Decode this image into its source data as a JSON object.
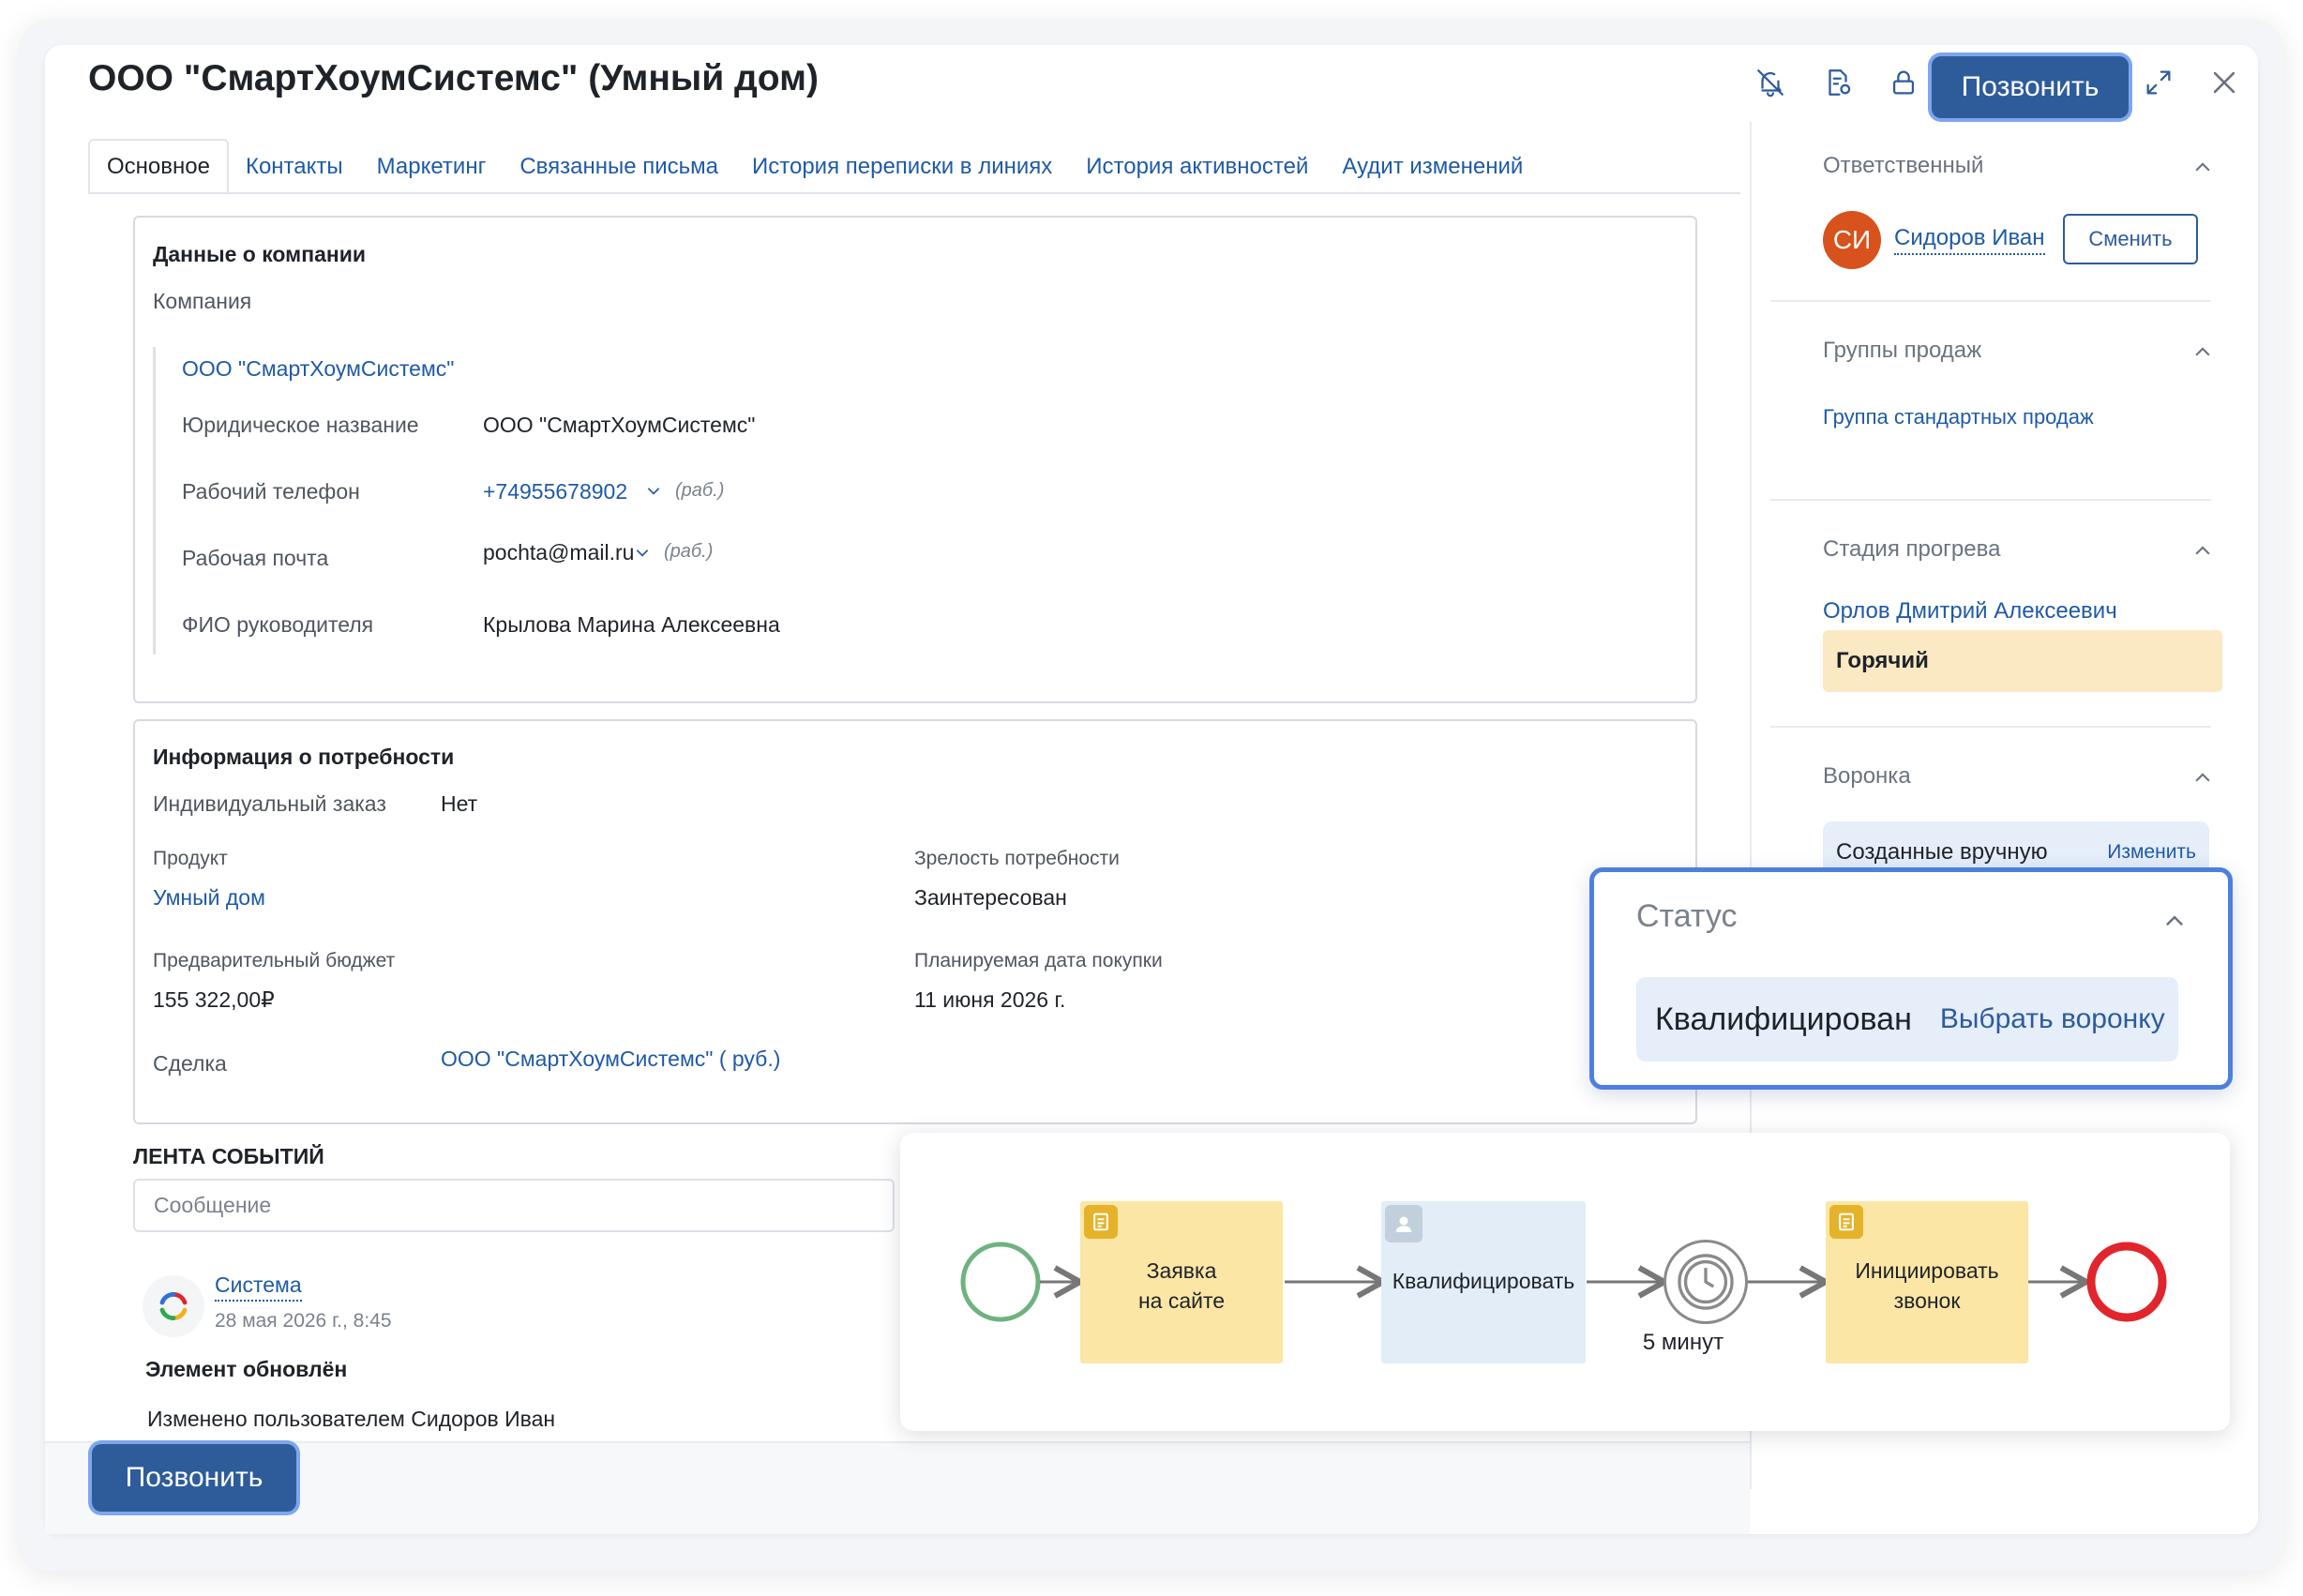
{
  "header": {
    "title": "ООО \"СмартХоумСистемс\" (Умный дом)",
    "call_label": "Позвонить"
  },
  "tabs": [
    {
      "label": "Основное",
      "active": true
    },
    {
      "label": "Контакты"
    },
    {
      "label": "Маркетинг"
    },
    {
      "label": "Связанные письма"
    },
    {
      "label": "История переписки в линиях"
    },
    {
      "label": "История активностей"
    },
    {
      "label": "Аудит изменений"
    }
  ],
  "company": {
    "section_title": "Данные о компании",
    "company_label": "Компания",
    "company_link": "ООО \"СмартХоумСистемс\"",
    "legal_name_label": "Юридическое название",
    "legal_name": "ООО \"СмартХоумСистемс\"",
    "phone_label": "Рабочий телефон",
    "phone": "+74955678902",
    "phone_tag": "(раб.)",
    "email_label": "Рабочая почта",
    "email": "pochta@mail.ru",
    "email_tag": "(раб.)",
    "head_label": "ФИО руководителя",
    "head": "Крылова Марина Алексеевна"
  },
  "need": {
    "section_title": "Информация о потребности",
    "individual_label": "Индивидуальный заказ",
    "individual": "Нет",
    "product_label": "Продукт",
    "product": "Умный дом",
    "maturity_label": "Зрелость потребности",
    "maturity": "Заинтересован",
    "budget_label": "Предварительный бюджет",
    "budget": "155 322,00₽",
    "purchase_date_label": "Планируемая дата покупки",
    "purchase_date": "11 июня 2026 г.",
    "deal_label": "Сделка",
    "deal": "ООО \"СмартХоумСистемс\" ( руб.)"
  },
  "feed": {
    "title": "ЛЕНТА СОБЫТИЙ",
    "message_placeholder": "Сообщение",
    "author": "Система",
    "date": "28 мая 2026 г., 8:45",
    "event_title": "Элемент обновлён",
    "event_text": "Изменено пользователем Сидоров Иван"
  },
  "sidebar": {
    "responsible": {
      "title": "Ответственный",
      "initials": "СИ",
      "name": "Сидоров Иван",
      "change_label": "Сменить"
    },
    "sales_groups": {
      "title": "Группы продаж",
      "value": "Группа стандартных продаж"
    },
    "warmup": {
      "title": "Стадия прогрева",
      "person": "Орлов Дмитрий Алексеевич",
      "value": "Горячий"
    },
    "funnel": {
      "title": "Воронка",
      "value": "Созданные вручную",
      "change_label": "Изменить"
    }
  },
  "status_card": {
    "title": "Статус",
    "value": "Квалифицирован",
    "action": "Выбрать воронку"
  },
  "process": {
    "step1": "Заявка\nна сайте",
    "step2": "Квалифицировать",
    "timer": "5 минут",
    "step3": "Инициировать\nзвонок"
  },
  "colors": {
    "accent": "#2e5c9a",
    "link": "#1f5aa6",
    "avatar": "#d7521c",
    "hot": "#fbe9c3",
    "task_yellow": "#fbe6a5",
    "task_blue": "#e2edf7",
    "start_event": "#6fb27f",
    "end_event": "#e0262c",
    "status_border": "#4d7fe0"
  },
  "icons": [
    "bell-off-icon",
    "document-settings-icon",
    "lock-icon",
    "expand-icon",
    "close-icon",
    "chevron-up-icon",
    "chevron-down-icon",
    "system-logo-icon",
    "document-icon",
    "user-icon",
    "timer-icon"
  ]
}
